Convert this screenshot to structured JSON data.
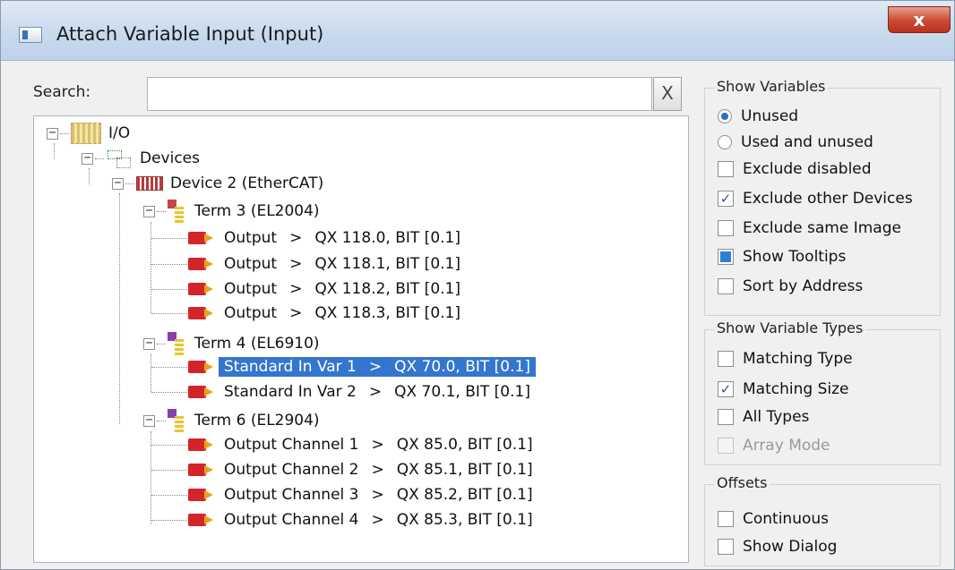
{
  "window": {
    "title": "Attach Variable Input (Input)",
    "close_glyph": "x"
  },
  "search": {
    "label": "Search:",
    "value": "",
    "clear_glyph": "X"
  },
  "tree": {
    "root": "I/O",
    "devices": "Devices",
    "device": "Device 2 (EtherCAT)",
    "terms": [
      {
        "label": "Term 3 (EL2004)",
        "vars": [
          {
            "name": "Output",
            "sep": ">",
            "addr": "QX 118.0, BIT [0.1]"
          },
          {
            "name": "Output",
            "sep": ">",
            "addr": "QX 118.1, BIT [0.1]"
          },
          {
            "name": "Output",
            "sep": ">",
            "addr": "QX 118.2, BIT [0.1]"
          },
          {
            "name": "Output",
            "sep": ">",
            "addr": "QX 118.3, BIT [0.1]"
          }
        ]
      },
      {
        "label": "Term 4 (EL6910)",
        "vars": [
          {
            "name": "Standard In Var 1",
            "sep": ">",
            "addr": "QX 70.0, BIT [0.1]"
          },
          {
            "name": "Standard In Var 2",
            "sep": ">",
            "addr": "QX 70.1, BIT [0.1]"
          }
        ]
      },
      {
        "label": "Term 6 (EL2904)",
        "vars": [
          {
            "name": "Output Channel 1",
            "sep": ">",
            "addr": "QX 85.0, BIT [0.1]"
          },
          {
            "name": "Output Channel 2",
            "sep": ">",
            "addr": "QX 85.1, BIT [0.1]"
          },
          {
            "name": "Output Channel 3",
            "sep": ">",
            "addr": "QX 85.2, BIT [0.1]"
          },
          {
            "name": "Output Channel 4",
            "sep": ">",
            "addr": "QX 85.3, BIT [0.1]"
          }
        ]
      }
    ]
  },
  "show_variables": {
    "title": "Show Variables",
    "unused": "Unused",
    "used_and_unused": "Used and unused",
    "exclude_disabled": "Exclude disabled",
    "exclude_other_devices": "Exclude other Devices",
    "exclude_same_image": "Exclude same Image",
    "show_tooltips": "Show Tooltips",
    "sort_by_address": "Sort by Address"
  },
  "show_variable_types": {
    "title": "Show Variable Types",
    "matching_type": "Matching Type",
    "matching_size": "Matching Size",
    "all_types": "All Types",
    "array_mode": "Array Mode"
  },
  "offsets": {
    "title": "Offsets",
    "continuous": "Continuous",
    "show_dialog": "Show Dialog"
  },
  "icons": {
    "io": "io-icon",
    "devices": "devices-icon",
    "ethercat": "ethercat-device-icon",
    "terminal": "terminal-icon",
    "variable": "output-variable-icon"
  },
  "colors": {
    "selection": "#3476cf",
    "title_bar": "#c9daee",
    "close_button": "#c94a32"
  }
}
